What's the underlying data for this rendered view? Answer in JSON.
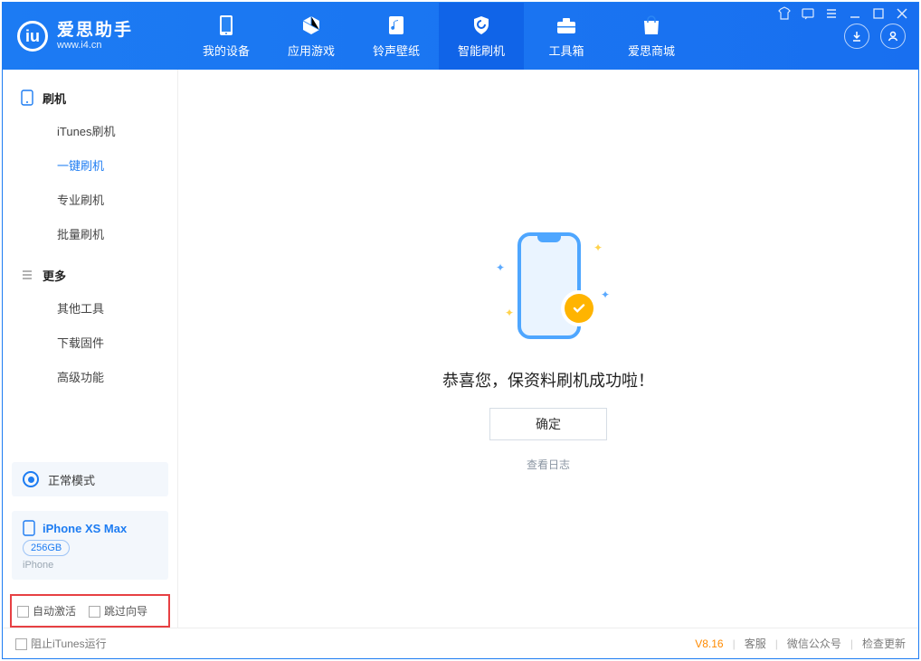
{
  "app": {
    "title": "爱思助手",
    "subtitle": "www.i4.cn"
  },
  "nav": {
    "items": [
      {
        "label": "我的设备",
        "icon": "phone-icon"
      },
      {
        "label": "应用游戏",
        "icon": "cube-icon"
      },
      {
        "label": "铃声壁纸",
        "icon": "music-icon"
      },
      {
        "label": "智能刷机",
        "icon": "shield-icon"
      },
      {
        "label": "工具箱",
        "icon": "toolbox-icon"
      },
      {
        "label": "爱思商城",
        "icon": "bag-icon"
      }
    ],
    "active_index": 3
  },
  "sidebar": {
    "groups": [
      {
        "title": "刷机",
        "icon": "device-icon",
        "items": [
          "iTunes刷机",
          "一键刷机",
          "专业刷机",
          "批量刷机"
        ],
        "active_index": 1
      },
      {
        "title": "更多",
        "icon": "list-icon",
        "items": [
          "其他工具",
          "下载固件",
          "高级功能"
        ],
        "active_index": -1
      }
    ],
    "mode": {
      "label": "正常模式"
    },
    "device": {
      "name": "iPhone XS Max",
      "storage": "256GB",
      "type": "iPhone"
    },
    "options": {
      "auto_activate": "自动激活",
      "skip_guide": "跳过向导"
    }
  },
  "main": {
    "message": "恭喜您，保资料刷机成功啦！",
    "confirm": "确定",
    "view_log": "查看日志"
  },
  "footer": {
    "block_itunes": "阻止iTunes运行",
    "version": "V8.16",
    "links": [
      "客服",
      "微信公众号",
      "检查更新"
    ]
  }
}
